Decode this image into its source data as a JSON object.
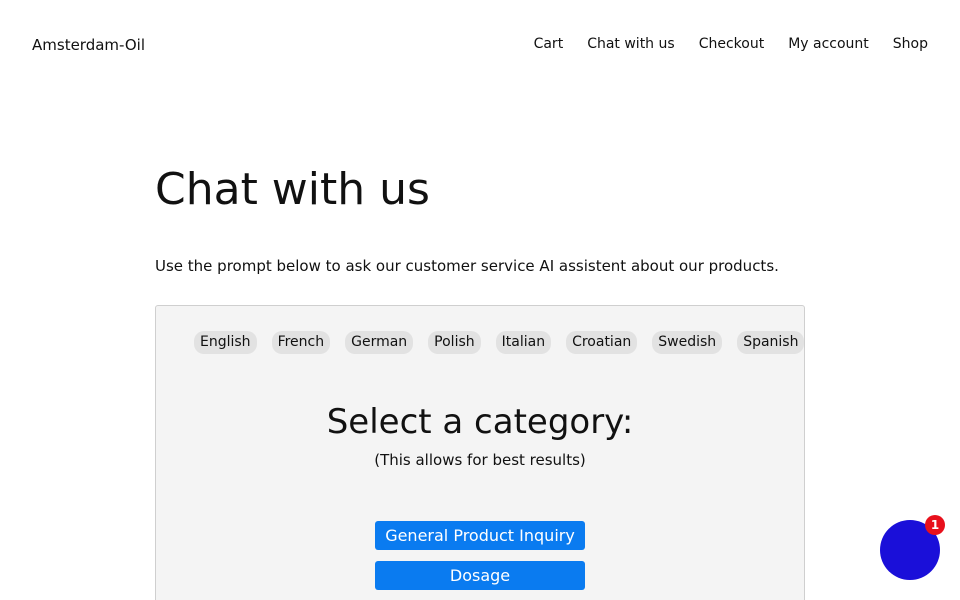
{
  "header": {
    "site_title": "Amsterdam-Oil",
    "nav": [
      "Cart",
      "Chat with us",
      "Checkout",
      "My account",
      "Shop"
    ]
  },
  "main": {
    "title": "Chat with us",
    "intro": "Use the prompt below to ask our customer service AI assistent about our products."
  },
  "chat": {
    "languages": [
      "English",
      "French",
      "German",
      "Polish",
      "Italian",
      "Croatian",
      "Swedish",
      "Spanish"
    ],
    "category_heading": "Select a category:",
    "category_sub": "(This allows for best results)",
    "categories": [
      "General Product Inquiry",
      "Dosage"
    ]
  },
  "fab": {
    "badge_count": "1",
    "icon": "chat-bubble-icon"
  },
  "colors": {
    "accent": "#0a7bf0",
    "fab": "#1a0fd9",
    "badge": "#e8101c",
    "panel": "#f4f4f4"
  }
}
